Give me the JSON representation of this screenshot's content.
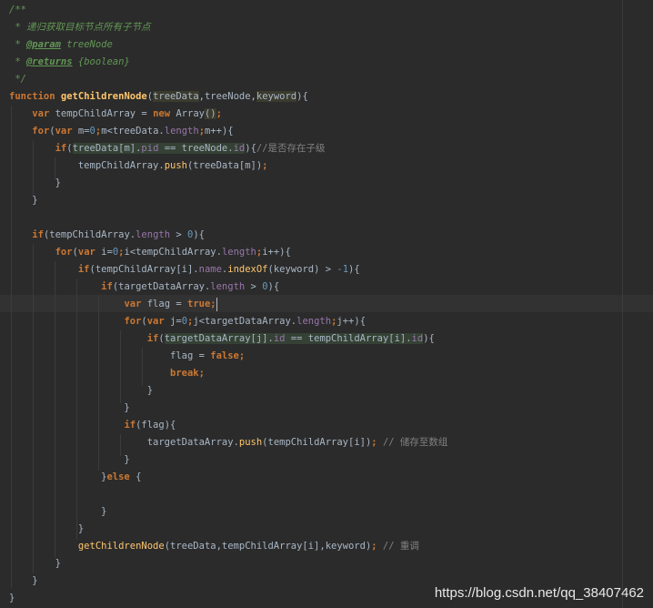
{
  "editor": {
    "language": "javascript",
    "theme_colors": {
      "background": "#2b2b2b",
      "keyword": "#cc7832",
      "function": "#ffc66d",
      "field": "#9876aa",
      "number": "#6897bb",
      "comment": "#629755",
      "line_comment": "#808080",
      "text": "#a9b7c6"
    },
    "caret_line": 13
  },
  "code_lines": [
    [
      {
        "t": "/**",
        "c": "cm"
      }
    ],
    [
      {
        "t": " * 递归获取目标节点所有子节点",
        "c": "cm"
      }
    ],
    [
      {
        "t": " * ",
        "c": "cm"
      },
      {
        "t": "@param",
        "c": "cmtag"
      },
      {
        "t": " treeNode",
        "c": "cm"
      }
    ],
    [
      {
        "t": " * ",
        "c": "cm"
      },
      {
        "t": "@returns",
        "c": "cmtag"
      },
      {
        "t": " {boolean}",
        "c": "cm"
      }
    ],
    [
      {
        "t": " */",
        "c": "cm"
      }
    ],
    [
      {
        "t": "function ",
        "c": "kw"
      },
      {
        "t": "getChildrenNode",
        "c": "fn"
      },
      {
        "t": "(",
        "c": "id"
      },
      {
        "t": "treeData",
        "c": "id",
        "h": "hl2"
      },
      {
        "t": ",",
        "c": "id"
      },
      {
        "t": "treeNode",
        "c": "id"
      },
      {
        "t": ",",
        "c": "id"
      },
      {
        "t": "keyword",
        "c": "id",
        "h": "hl2"
      },
      {
        "t": "){",
        "c": "id"
      }
    ],
    [
      {
        "t": "    ",
        "c": "id"
      },
      {
        "t": "var ",
        "c": "kw"
      },
      {
        "t": "tempChildArray = ",
        "c": "id"
      },
      {
        "t": "new ",
        "c": "kw"
      },
      {
        "t": "Array",
        "c": "id"
      },
      {
        "t": "()",
        "c": "id",
        "h": "hl2"
      },
      {
        "t": ";",
        "c": "kw"
      }
    ],
    [
      {
        "t": "    ",
        "c": "id"
      },
      {
        "t": "for",
        "c": "kw"
      },
      {
        "t": "(",
        "c": "id"
      },
      {
        "t": "var ",
        "c": "kw"
      },
      {
        "t": "m=",
        "c": "id"
      },
      {
        "t": "0",
        "c": "num"
      },
      {
        "t": ";",
        "c": "kw"
      },
      {
        "t": "m<treeData.",
        "c": "id"
      },
      {
        "t": "length",
        "c": "fld"
      },
      {
        "t": ";",
        "c": "kw"
      },
      {
        "t": "m++){",
        "c": "id"
      }
    ],
    [
      {
        "t": "        ",
        "c": "id"
      },
      {
        "t": "if",
        "c": "kw"
      },
      {
        "t": "(",
        "c": "id"
      },
      {
        "t": "treeData[m].",
        "c": "id",
        "h": "hl"
      },
      {
        "t": "pid",
        "c": "fld",
        "h": "hl"
      },
      {
        "t": " == treeNode.",
        "c": "id",
        "h": "hl"
      },
      {
        "t": "id",
        "c": "fld",
        "h": "hl"
      },
      {
        "t": ")",
        "c": "id"
      },
      {
        "t": "{",
        "c": "id"
      },
      {
        "t": "//是否存在子级",
        "c": "lc"
      }
    ],
    [
      {
        "t": "            tempChildArray.",
        "c": "id"
      },
      {
        "t": "push",
        "c": "mth"
      },
      {
        "t": "(treeData[m])",
        "c": "id"
      },
      {
        "t": ";",
        "c": "kw"
      }
    ],
    [
      {
        "t": "        }",
        "c": "id"
      }
    ],
    [
      {
        "t": "    }",
        "c": "id"
      }
    ],
    [
      {
        "t": "",
        "c": "id"
      }
    ],
    [
      {
        "t": "    ",
        "c": "id"
      },
      {
        "t": "if",
        "c": "kw"
      },
      {
        "t": "(tempChildArray.",
        "c": "id"
      },
      {
        "t": "length",
        "c": "fld"
      },
      {
        "t": " > ",
        "c": "id"
      },
      {
        "t": "0",
        "c": "num"
      },
      {
        "t": "){",
        "c": "id"
      }
    ],
    [
      {
        "t": "        ",
        "c": "id"
      },
      {
        "t": "for",
        "c": "kw"
      },
      {
        "t": "(",
        "c": "id"
      },
      {
        "t": "var ",
        "c": "kw"
      },
      {
        "t": "i=",
        "c": "id"
      },
      {
        "t": "0",
        "c": "num"
      },
      {
        "t": ";",
        "c": "kw"
      },
      {
        "t": "i<tempChildArray.",
        "c": "id"
      },
      {
        "t": "length",
        "c": "fld"
      },
      {
        "t": ";",
        "c": "kw"
      },
      {
        "t": "i++){",
        "c": "id"
      }
    ],
    [
      {
        "t": "            ",
        "c": "id"
      },
      {
        "t": "if",
        "c": "kw"
      },
      {
        "t": "(tempChildArray[i].",
        "c": "id"
      },
      {
        "t": "name",
        "c": "fld"
      },
      {
        "t": ".",
        "c": "id"
      },
      {
        "t": "indexOf",
        "c": "mth"
      },
      {
        "t": "(keyword) > ",
        "c": "id"
      },
      {
        "t": "-1",
        "c": "num"
      },
      {
        "t": "){",
        "c": "id"
      }
    ],
    [
      {
        "t": "                ",
        "c": "id"
      },
      {
        "t": "if",
        "c": "kw"
      },
      {
        "t": "(targetDataArray.",
        "c": "id"
      },
      {
        "t": "length",
        "c": "fld"
      },
      {
        "t": " > ",
        "c": "id"
      },
      {
        "t": "0",
        "c": "num"
      },
      {
        "t": "){",
        "c": "id"
      }
    ],
    [
      {
        "t": "                    ",
        "c": "id"
      },
      {
        "t": "var ",
        "c": "kw"
      },
      {
        "t": "flag = ",
        "c": "id"
      },
      {
        "t": "true",
        "c": "kw"
      },
      {
        "t": ";",
        "c": "kw"
      },
      {
        "t": "CARET",
        "c": "caret"
      }
    ],
    [
      {
        "t": "                    ",
        "c": "id"
      },
      {
        "t": "for",
        "c": "kw"
      },
      {
        "t": "(",
        "c": "id"
      },
      {
        "t": "var ",
        "c": "kw"
      },
      {
        "t": "j=",
        "c": "id"
      },
      {
        "t": "0",
        "c": "num"
      },
      {
        "t": ";",
        "c": "kw"
      },
      {
        "t": "j<targetDataArray.",
        "c": "id"
      },
      {
        "t": "length",
        "c": "fld"
      },
      {
        "t": ";",
        "c": "kw"
      },
      {
        "t": "j++){",
        "c": "id"
      }
    ],
    [
      {
        "t": "                        ",
        "c": "id"
      },
      {
        "t": "if",
        "c": "kw"
      },
      {
        "t": "(",
        "c": "id"
      },
      {
        "t": "targetDataArray[j].",
        "c": "id",
        "h": "hl"
      },
      {
        "t": "id",
        "c": "fld",
        "h": "hl"
      },
      {
        "t": " == tempChildArray[i].",
        "c": "id",
        "h": "hl"
      },
      {
        "t": "id",
        "c": "fld",
        "h": "hl"
      },
      {
        "t": "){",
        "c": "id"
      }
    ],
    [
      {
        "t": "                            flag = ",
        "c": "id"
      },
      {
        "t": "false",
        "c": "kw"
      },
      {
        "t": ";",
        "c": "kw"
      }
    ],
    [
      {
        "t": "                            ",
        "c": "id"
      },
      {
        "t": "break",
        "c": "kw"
      },
      {
        "t": ";",
        "c": "kw"
      }
    ],
    [
      {
        "t": "                        }",
        "c": "id"
      }
    ],
    [
      {
        "t": "                    }",
        "c": "id"
      }
    ],
    [
      {
        "t": "                    ",
        "c": "id"
      },
      {
        "t": "if",
        "c": "kw"
      },
      {
        "t": "(flag){",
        "c": "id"
      }
    ],
    [
      {
        "t": "                        targetDataArray.",
        "c": "id"
      },
      {
        "t": "push",
        "c": "mth"
      },
      {
        "t": "(tempChildArray[i])",
        "c": "id"
      },
      {
        "t": "; ",
        "c": "kw"
      },
      {
        "t": "// 储存至数组",
        "c": "lc"
      }
    ],
    [
      {
        "t": "                    }",
        "c": "id"
      }
    ],
    [
      {
        "t": "                }",
        "c": "id"
      },
      {
        "t": "else ",
        "c": "kw"
      },
      {
        "t": "{",
        "c": "id"
      }
    ],
    [
      {
        "t": "",
        "c": "id"
      }
    ],
    [
      {
        "t": "                }",
        "c": "id"
      }
    ],
    [
      {
        "t": "            }",
        "c": "id"
      }
    ],
    [
      {
        "t": "            ",
        "c": "id"
      },
      {
        "t": "getChildrenNode",
        "c": "mth"
      },
      {
        "t": "(treeData,tempChildArray[i],keyword)",
        "c": "id"
      },
      {
        "t": "; ",
        "c": "kw"
      },
      {
        "t": "// 重调",
        "c": "lc"
      }
    ],
    [
      {
        "t": "        }",
        "c": "id"
      }
    ],
    [
      {
        "t": "    }",
        "c": "id"
      }
    ],
    [
      {
        "t": "}",
        "c": "id"
      }
    ]
  ],
  "watermark": "https://blog.csdn.net/qq_38407462"
}
